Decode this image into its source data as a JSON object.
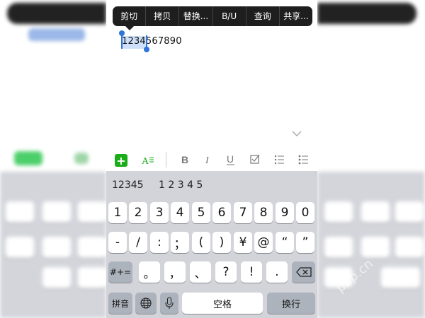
{
  "context_menu": {
    "items": [
      "剪切",
      "拷贝",
      "替换...",
      "B/U",
      "查询",
      "共享..."
    ]
  },
  "editor": {
    "text": "1234567890"
  },
  "candidate_bar": {
    "items": [
      "12345",
      "1 2 3 4 5"
    ]
  },
  "keyboard": {
    "row1": [
      "1",
      "2",
      "3",
      "4",
      "5",
      "6",
      "7",
      "8",
      "9",
      "0"
    ],
    "row2": [
      "-",
      "/",
      ":",
      "；",
      "(",
      ")",
      "¥",
      "@",
      "“",
      "”"
    ],
    "row3_switch": "#+=",
    "row3": [
      "。",
      "，",
      "、",
      "?",
      "!",
      "."
    ],
    "pinyin_key": "拼音",
    "space_key": "空格",
    "return_key": "换行"
  },
  "watermark": "php.cn",
  "colors": {
    "menu_bg": "#1e1e1e",
    "selection_handle": "#2f74d8",
    "insert_button": "#1aad19",
    "keyboard_bg": "#d2d4da"
  }
}
